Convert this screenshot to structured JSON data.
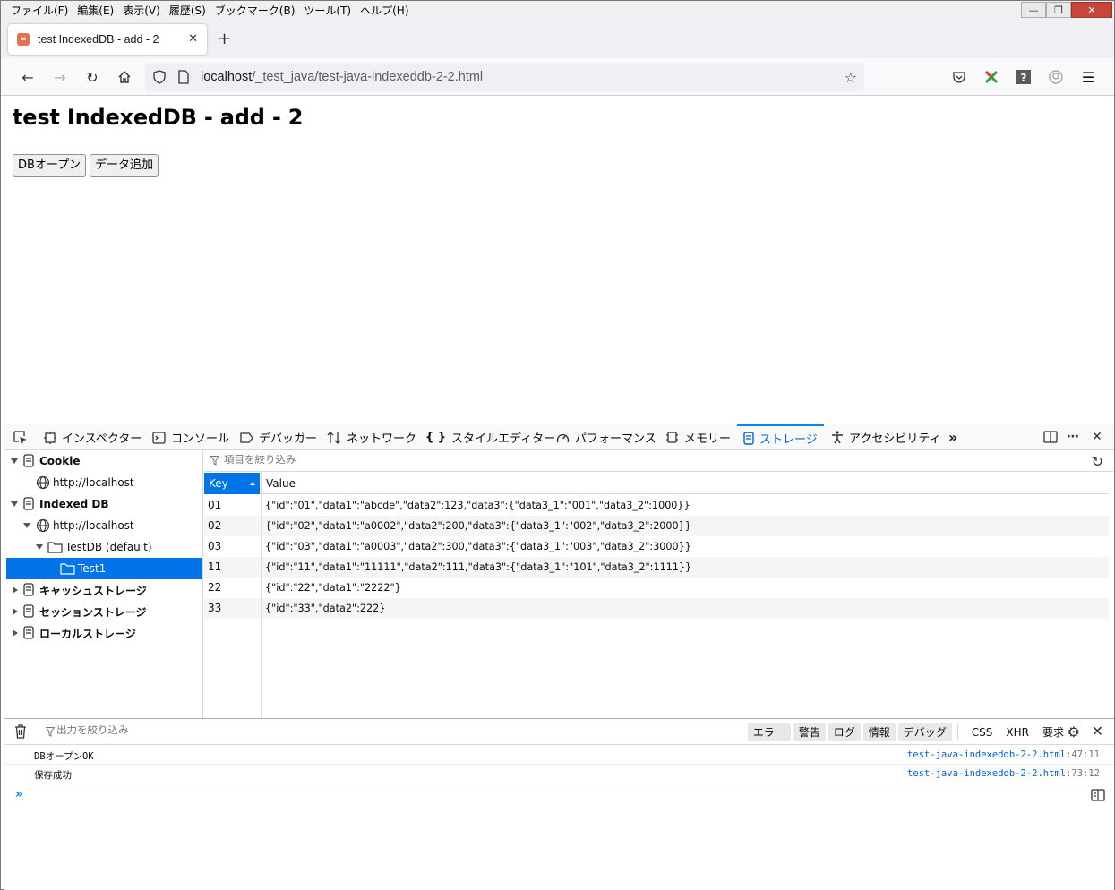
{
  "menu": [
    "ファイル(F)",
    "編集(E)",
    "表示(V)",
    "履歴(S)",
    "ブックマーク(B)",
    "ツール(T)",
    "ヘルプ(H)"
  ],
  "tab": {
    "title": "test IndexedDB - add - 2"
  },
  "urlbar": {
    "host": "localhost",
    "path": "/_test_java/test-java-indexeddb-2-2.html"
  },
  "page": {
    "heading": "test IndexedDB - add - 2",
    "buttons": [
      "DBオープン",
      "データ追加"
    ]
  },
  "devtools": {
    "tabs": [
      "インスペクター",
      "コンソール",
      "デバッガー",
      "ネットワーク",
      "スタイルエディター",
      "パフォーマンス",
      "メモリー",
      "ストレージ",
      "アクセシビリティ"
    ],
    "active_tab": "ストレージ",
    "tree": {
      "cookie": "Cookie",
      "cookie_host": "http://localhost",
      "indexeddb": "Indexed DB",
      "idb_host": "http://localhost",
      "db": "TestDB (default)",
      "store": "Test1",
      "cache": "キャッシュストレージ",
      "session": "セッションストレージ",
      "local": "ローカルストレージ"
    },
    "filter_placeholder": "項目を絞り込み",
    "table": {
      "columns": [
        "Key",
        "Value"
      ],
      "rows": [
        {
          "key": "01",
          "value": "{\"id\":\"01\",\"data1\":\"abcde\",\"data2\":123,\"data3\":{\"data3_1\":\"001\",\"data3_2\":1000}}"
        },
        {
          "key": "02",
          "value": "{\"id\":\"02\",\"data1\":\"a0002\",\"data2\":200,\"data3\":{\"data3_1\":\"002\",\"data3_2\":2000}}"
        },
        {
          "key": "03",
          "value": "{\"id\":\"03\",\"data1\":\"a0003\",\"data2\":300,\"data3\":{\"data3_1\":\"003\",\"data3_2\":3000}}"
        },
        {
          "key": "11",
          "value": "{\"id\":\"11\",\"data1\":\"11111\",\"data2\":111,\"data3\":{\"data3_1\":\"101\",\"data3_2\":1111}}"
        },
        {
          "key": "22",
          "value": "{\"id\":\"22\",\"data1\":\"2222\"}"
        },
        {
          "key": "33",
          "value": "{\"id\":\"33\",\"data2\":222}"
        }
      ]
    },
    "console": {
      "filter_placeholder": "出力を絞り込み",
      "filters": [
        "エラー",
        "警告",
        "ログ",
        "情報",
        "デバッグ"
      ],
      "extra_filters": [
        "CSS",
        "XHR",
        "要求"
      ],
      "messages": [
        {
          "text": "DBオープンOK",
          "file": "test-java-indexeddb-2-2.html",
          "line": ":47:11"
        },
        {
          "text": "保存成功",
          "file": "test-java-indexeddb-2-2.html",
          "line": ":73:12"
        }
      ]
    }
  }
}
